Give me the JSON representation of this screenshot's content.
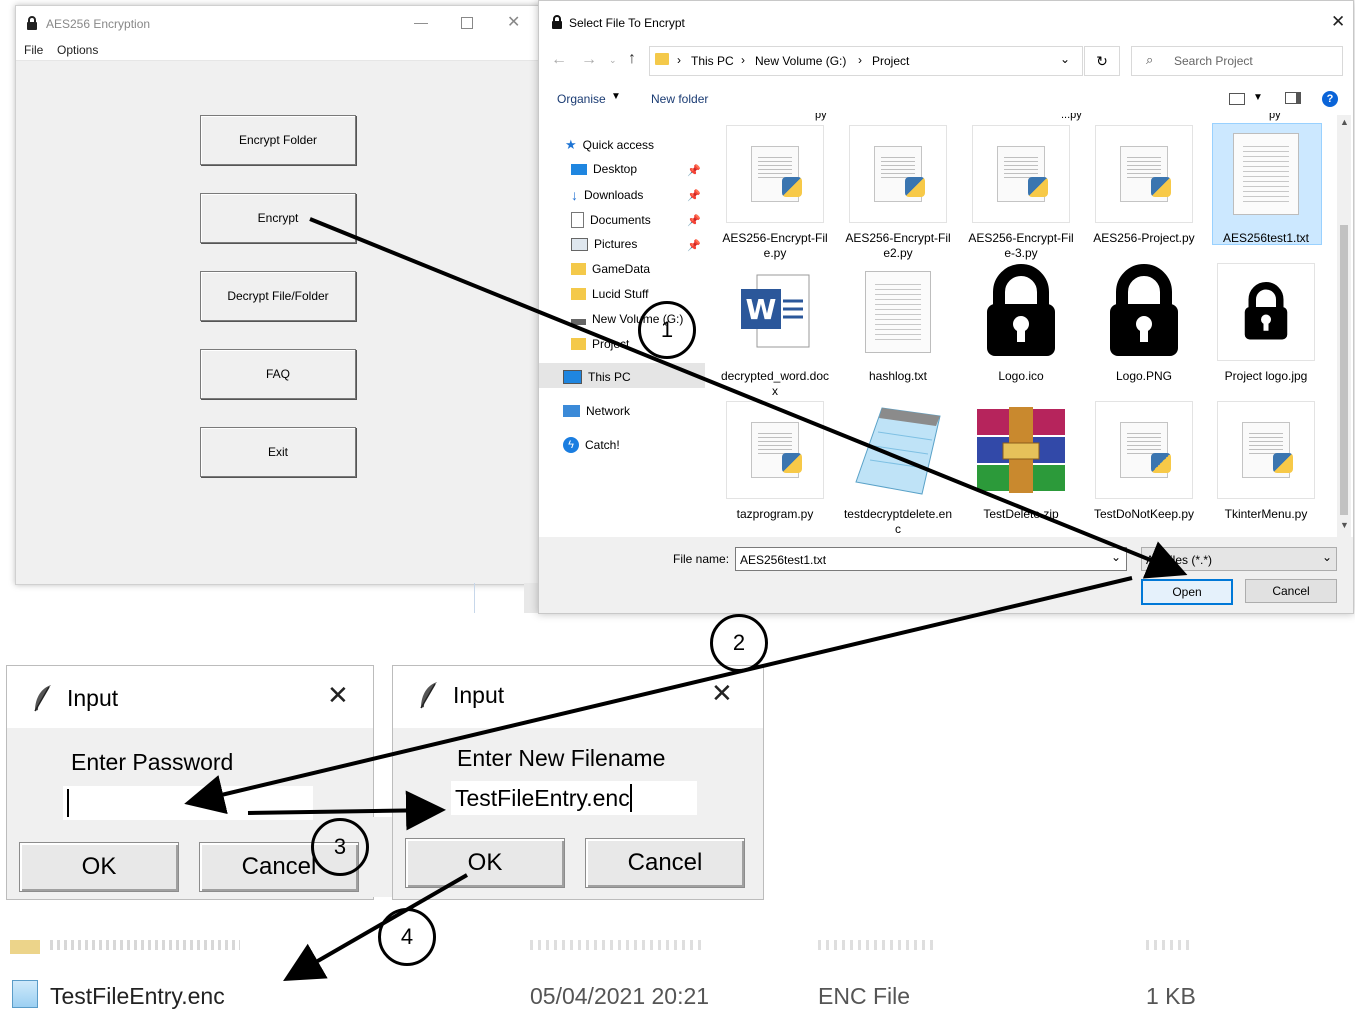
{
  "main_window": {
    "title": "AES256 Encryption",
    "menu": [
      "File",
      "Options"
    ],
    "buttons": [
      "Encrypt Folder",
      "Encrypt",
      "Decrypt File/Folder",
      "FAQ",
      "Exit"
    ]
  },
  "file_dialog": {
    "title": "Select File To Encrypt",
    "breadcrumb": [
      "This PC",
      "New Volume (G:)",
      "Project"
    ],
    "search_placeholder": "Search Project",
    "toolbar": {
      "organise": "Organise",
      "new_folder": "New folder"
    },
    "nav": [
      "Quick access",
      "Desktop",
      "Downloads",
      "Documents",
      "Pictures",
      "GameData",
      "Lucid Stuff",
      "New Volume (G:)",
      "Project",
      "This PC",
      "Network",
      "Catch!"
    ],
    "files": [
      "AES256-Encrypt-File.py",
      "AES256-Encrypt-File2.py",
      "AES256-Encrypt-File-3.py",
      "AES256-Project.py",
      "AES256test1.txt",
      "decrypted_word.docx",
      "hashlog.txt",
      "Logo.ico",
      "Logo.PNG",
      "Project logo.jpg",
      "tazprogram.py",
      "testdecryptdelete.enc",
      "TestDelete.zip",
      "TestDoNotKeep.py",
      "TkinterMenu.py"
    ],
    "filename_label": "File name:",
    "filename_value": "AES256test1.txt",
    "filter_value": "All Files (*.*)",
    "open_label": "Open",
    "cancel_label": "Cancel"
  },
  "password_dialog": {
    "title": "Input",
    "prompt": "Enter Password",
    "value": "",
    "ok_label": "OK",
    "cancel_label": "Cancel"
  },
  "filename_dialog": {
    "title": "Input",
    "prompt": "Enter New Filename",
    "value": "TestFileEntry.enc",
    "ok_label": "OK",
    "cancel_label": "Cancel"
  },
  "explorer_rows": [
    {
      "name": "TestFileEntry.enc",
      "date": "05/04/2021 20:21",
      "type": "ENC File",
      "size": "1 KB"
    }
  ],
  "steps": [
    "1",
    "2",
    "3",
    "4"
  ],
  "colors": {
    "accent": "#0078d7",
    "dialog_bg": "#f0f0f0",
    "selection": "#cce8ff"
  }
}
